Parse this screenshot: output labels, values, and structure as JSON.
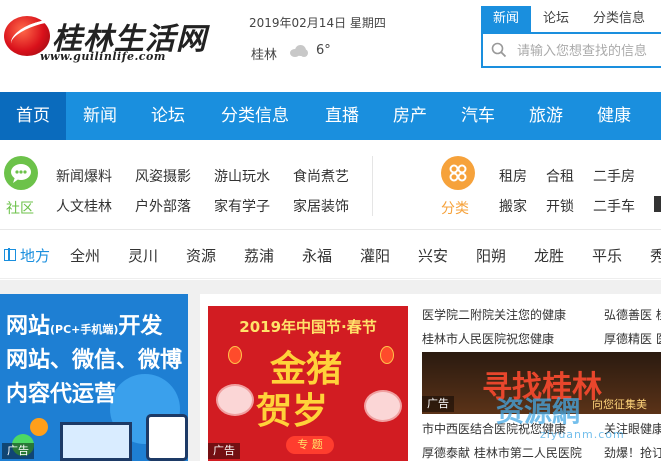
{
  "logo": {
    "title": "桂林生活网",
    "url": "www.guilinlife.com"
  },
  "header": {
    "date": "2019年02月14日 星期四",
    "city": "桂林",
    "temperature": "6°"
  },
  "search": {
    "tabs": [
      {
        "label": "新闻"
      },
      {
        "label": "论坛"
      },
      {
        "label": "分类信息"
      }
    ],
    "placeholder": "请输入您想查找的信息"
  },
  "mainnav": {
    "items": [
      {
        "label": "首页"
      },
      {
        "label": "新闻"
      },
      {
        "label": "论坛"
      },
      {
        "label": "分类信息"
      },
      {
        "label": "直播"
      },
      {
        "label": "房产"
      },
      {
        "label": "汽车"
      },
      {
        "label": "旅游"
      },
      {
        "label": "健康"
      }
    ]
  },
  "community": {
    "title": "社区",
    "links": [
      "新闻爆料",
      "风姿摄影",
      "游山玩水",
      "食尚煮艺",
      "人文桂林",
      "户外部落",
      "家有学子",
      "家居装饰"
    ]
  },
  "classified": {
    "title": "分类",
    "links": [
      "租房",
      "合租",
      "二手房",
      "搬家",
      "开锁",
      "二手车"
    ]
  },
  "regions": {
    "title": "地方",
    "items": [
      "全州",
      "灵川",
      "资源",
      "荔浦",
      "永福",
      "灌阳",
      "兴安",
      "阳朔",
      "龙胜",
      "平乐",
      "秀"
    ]
  },
  "ads": {
    "left": {
      "line1": "网站",
      "line1_small": "(PC+手机端)",
      "line1_tail": "开发",
      "line2": "网站、微信、微博",
      "line3": "内容代运营"
    },
    "spring": {
      "banner": "2019年中国节·春节",
      "big1": "金猪",
      "big2": "贺岁",
      "topic": "专 题",
      "tag": "广告"
    },
    "find": {
      "text": "寻找桂林",
      "sub": "向您征集美",
      "tag": "广告"
    }
  },
  "news": {
    "col1": [
      "医学院二附院关注您的健康",
      "桂林市人民医院祝您健康",
      "市中西医结合医院祝您健康",
      "厚德泰献 桂林市第二人民医院"
    ],
    "col2": [
      "弘德善医 桂",
      "厚德精医 医",
      "关注眼健康",
      "劲爆！抢订"
    ]
  },
  "watermark": {
    "text": "资源網",
    "sub": "ziyuanm.com"
  },
  "colors": {
    "brand_blue": "#1a8fde",
    "nav_active": "#0a6bbd",
    "community_green": "#6cc24a",
    "classified_orange": "#f6a23b"
  }
}
